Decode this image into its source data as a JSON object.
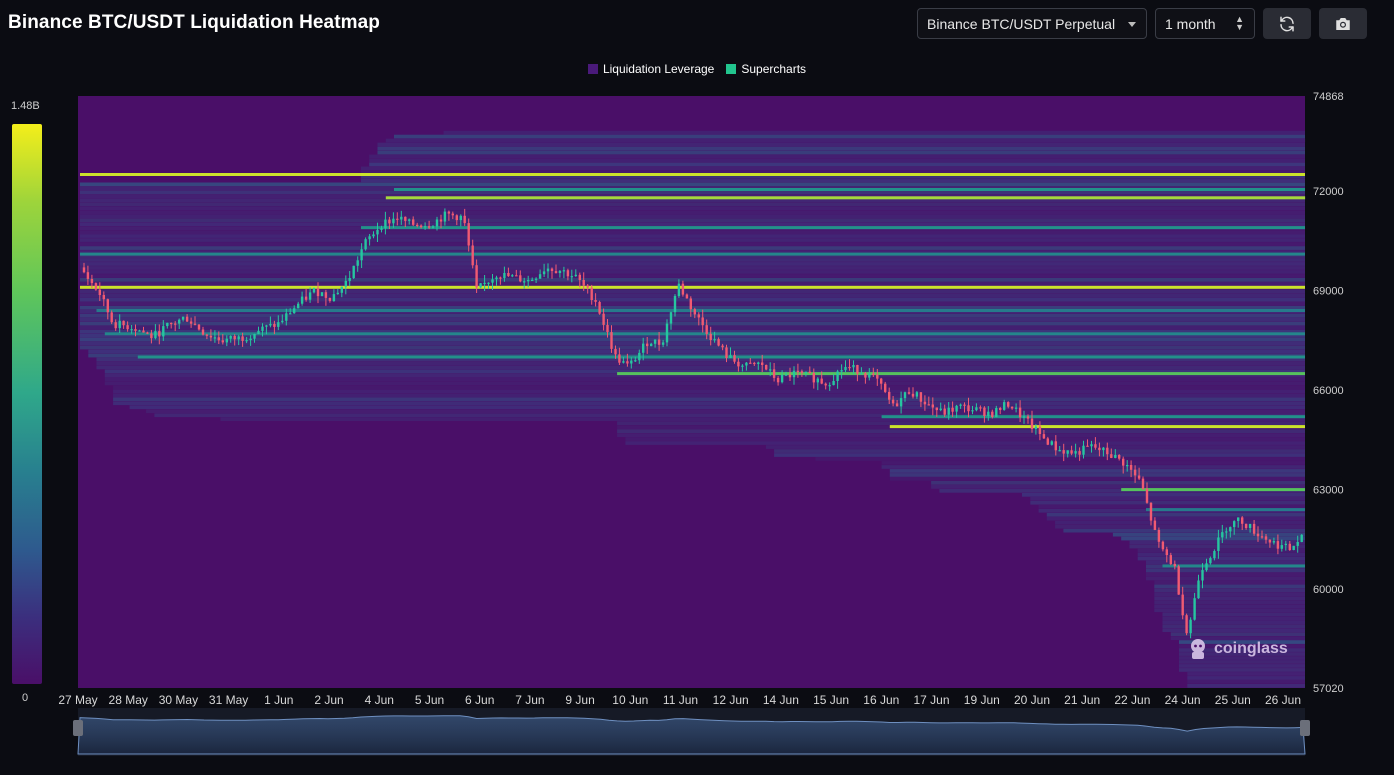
{
  "header": {
    "title": "Binance BTC/USDT Liquidation Heatmap",
    "market_select": "Binance BTC/USDT Perpetual",
    "range_select": "1 month"
  },
  "legend": [
    {
      "label": "Liquidation Leverage",
      "color": "#4a1a7a"
    },
    {
      "label": "Supercharts",
      "color": "#22c58e"
    }
  ],
  "color_scale": {
    "max_label": "1.48B",
    "min_label": "0"
  },
  "watermark": "coinglass",
  "icons": {
    "refresh": "refresh-icon",
    "camera": "camera-icon"
  },
  "colors": {
    "background": "#0b0c12",
    "heatmap_base": "#4a0f68",
    "bull": "#26c6a0",
    "bear": "#f05a72"
  },
  "chart_data": {
    "type": "heatmap",
    "title": "Binance BTC/USDT Liquidation Heatmap",
    "ylim": [
      57020,
      74868
    ],
    "y_ticks": [
      "74868",
      "72000",
      "69000",
      "66000",
      "63000",
      "60000",
      "57020"
    ],
    "x_ticks": [
      "27 May",
      "28 May",
      "30 May",
      "31 May",
      "1 Jun",
      "2 Jun",
      "4 Jun",
      "5 Jun",
      "6 Jun",
      "7 Jun",
      "9 Jun",
      "10 Jun",
      "11 Jun",
      "12 Jun",
      "14 Jun",
      "15 Jun",
      "16 Jun",
      "17 Jun",
      "19 Jun",
      "20 Jun",
      "21 Jun",
      "22 Jun",
      "24 Jun",
      "25 Jun",
      "26 Jun"
    ],
    "price_path": [
      [
        0,
        69700
      ],
      [
        0.6,
        68900
      ],
      [
        1,
        68000
      ],
      [
        1.6,
        67900
      ],
      [
        2.2,
        67600
      ],
      [
        2.6,
        67900
      ],
      [
        3.2,
        68200
      ],
      [
        3.8,
        67700
      ],
      [
        4.3,
        67500
      ],
      [
        5,
        67600
      ],
      [
        5.4,
        67800
      ],
      [
        6,
        68000
      ],
      [
        6.6,
        68600
      ],
      [
        7.1,
        69000
      ],
      [
        7.6,
        68800
      ],
      [
        8.1,
        69300
      ],
      [
        8.6,
        70400
      ],
      [
        9.1,
        71000
      ],
      [
        9.6,
        71200
      ],
      [
        10,
        71000
      ],
      [
        10.6,
        71000
      ],
      [
        11.1,
        71300
      ],
      [
        11.6,
        71200
      ],
      [
        12,
        69000
      ],
      [
        12.6,
        69500
      ],
      [
        13.1,
        69400
      ],
      [
        13.6,
        69300
      ],
      [
        14.1,
        69700
      ],
      [
        14.6,
        69600
      ],
      [
        15,
        69400
      ],
      [
        15.6,
        68700
      ],
      [
        16.2,
        67000
      ],
      [
        16.6,
        66700
      ],
      [
        17.2,
        67500
      ],
      [
        17.6,
        67400
      ],
      [
        18.1,
        69200
      ],
      [
        18.6,
        68300
      ],
      [
        19.1,
        67600
      ],
      [
        19.6,
        67000
      ],
      [
        20.1,
        66700
      ],
      [
        20.6,
        66800
      ],
      [
        21.1,
        66300
      ],
      [
        21.6,
        66500
      ],
      [
        22.1,
        66400
      ],
      [
        22.6,
        66200
      ],
      [
        23.1,
        66700
      ],
      [
        23.6,
        66600
      ],
      [
        24.1,
        66300
      ],
      [
        24.6,
        65500
      ],
      [
        25.1,
        66000
      ],
      [
        25.6,
        65600
      ],
      [
        26.1,
        65300
      ],
      [
        26.6,
        65500
      ],
      [
        27.1,
        65400
      ],
      [
        27.6,
        65300
      ],
      [
        28.1,
        65600
      ],
      [
        28.6,
        65100
      ],
      [
        29.1,
        64600
      ],
      [
        29.6,
        64200
      ],
      [
        30.1,
        64100
      ],
      [
        30.6,
        64300
      ],
      [
        31.1,
        64100
      ],
      [
        31.6,
        63800
      ],
      [
        32.1,
        63200
      ],
      [
        32.6,
        61400
      ],
      [
        33.1,
        60700
      ],
      [
        33.5,
        58600
      ],
      [
        33.9,
        60600
      ],
      [
        34.3,
        61200
      ],
      [
        34.7,
        61900
      ],
      [
        35.1,
        62100
      ],
      [
        35.6,
        61700
      ],
      [
        36.1,
        61400
      ],
      [
        36.6,
        61200
      ],
      [
        37,
        61600
      ]
    ],
    "liquidation_levels": [
      {
        "price": 72500,
        "intensity": 0.95
      },
      {
        "price": 72050,
        "intensity": 0.6
      },
      {
        "price": 71800,
        "intensity": 0.9
      },
      {
        "price": 70900,
        "intensity": 0.6
      },
      {
        "price": 70100,
        "intensity": 0.55
      },
      {
        "price": 69100,
        "intensity": 0.95
      },
      {
        "price": 68400,
        "intensity": 0.5
      },
      {
        "price": 67700,
        "intensity": 0.55
      },
      {
        "price": 67000,
        "intensity": 0.6
      },
      {
        "price": 66500,
        "intensity": 0.8
      },
      {
        "price": 65200,
        "intensity": 0.6
      },
      {
        "price": 64900,
        "intensity": 0.95
      },
      {
        "price": 63000,
        "intensity": 0.8
      },
      {
        "price": 62400,
        "intensity": 0.5
      },
      {
        "price": 60700,
        "intensity": 0.55
      }
    ]
  }
}
